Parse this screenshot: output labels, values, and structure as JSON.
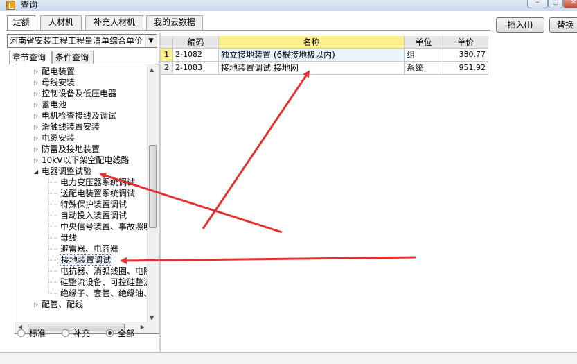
{
  "window": {
    "title": "查询",
    "colors": {
      "accent": "#e53030",
      "header_highlight": "#fdef8a",
      "selection": "#3b6fb6"
    }
  },
  "tabs": [
    {
      "label": "定额",
      "active": true
    },
    {
      "label": "人材机",
      "active": false
    },
    {
      "label": "补充人材机",
      "active": false
    },
    {
      "label": "我的云数据",
      "active": false
    }
  ],
  "toolbar": {
    "insert_label": "插入(I)",
    "replace_label": "替换"
  },
  "left": {
    "library": "河南省安装工程工程量清单综合单价",
    "subtabs": [
      {
        "label": "章节查询",
        "active": true
      },
      {
        "label": "条件查询",
        "active": false
      }
    ],
    "tree": [
      {
        "label": "配电装置",
        "level": 1,
        "state": "collapsed"
      },
      {
        "label": "母线安装",
        "level": 1,
        "state": "collapsed"
      },
      {
        "label": "控制设备及低压电器",
        "level": 1,
        "state": "collapsed"
      },
      {
        "label": "蓄电池",
        "level": 1,
        "state": "collapsed"
      },
      {
        "label": "电机检查接线及调试",
        "level": 1,
        "state": "collapsed"
      },
      {
        "label": "滑触线装置安装",
        "level": 1,
        "state": "collapsed"
      },
      {
        "label": "电缆安装",
        "level": 1,
        "state": "collapsed"
      },
      {
        "label": "防雷及接地装置",
        "level": 1,
        "state": "collapsed"
      },
      {
        "label": "10kV以下架空配电线路",
        "level": 1,
        "state": "collapsed"
      },
      {
        "label": "电器调整试验",
        "level": 1,
        "state": "expanded"
      },
      {
        "label": "电力变压器系统调试",
        "level": 2,
        "state": "leaf"
      },
      {
        "label": "送配电装置系统调试",
        "level": 2,
        "state": "leaf"
      },
      {
        "label": "特殊保护装置调试",
        "level": 2,
        "state": "leaf"
      },
      {
        "label": "自动投入装置调试",
        "level": 2,
        "state": "leaf"
      },
      {
        "label": "中央信号装置、事故照明",
        "level": 2,
        "state": "leaf"
      },
      {
        "label": "母线",
        "level": 2,
        "state": "leaf"
      },
      {
        "label": "避雷器、电容器",
        "level": 2,
        "state": "leaf"
      },
      {
        "label": "接地装置调试",
        "level": 2,
        "state": "selected"
      },
      {
        "label": "电抗器、消弧线圈、电除",
        "level": 2,
        "state": "leaf"
      },
      {
        "label": "硅整流设备、可控硅整流",
        "level": 2,
        "state": "leaf"
      },
      {
        "label": "绝缘子、套管、绝缘油、",
        "level": 2,
        "state": "leaf"
      },
      {
        "label": "配管、配线",
        "level": 1,
        "state": "collapsed"
      }
    ],
    "filters": [
      {
        "label": "标准",
        "checked": false
      },
      {
        "label": "补充",
        "checked": false
      },
      {
        "label": "全部",
        "checked": true
      }
    ]
  },
  "grid": {
    "columns": [
      "编码",
      "名称",
      "单位",
      "单价"
    ],
    "rows": [
      {
        "num": "1",
        "code": "2-1082",
        "name": "独立接地装置 (6根接地极以内)",
        "unit": "组",
        "price": "380.77"
      },
      {
        "num": "2",
        "code": "2-1083",
        "name": "接地装置调试 接地网",
        "unit": "系统",
        "price": "951.92"
      }
    ]
  }
}
